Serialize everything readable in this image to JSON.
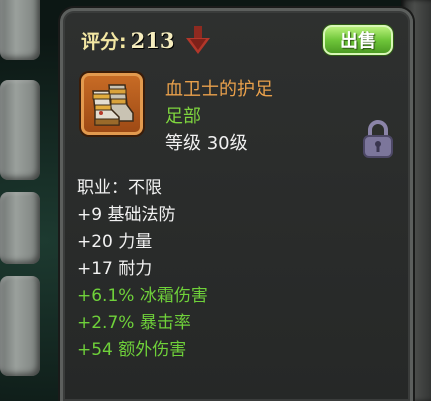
{
  "header": {
    "score_label": "评分:",
    "score_value": "213",
    "sell_button": "出售"
  },
  "item": {
    "name": "血卫士的护足",
    "slot": "足部",
    "level": "等级 30级",
    "icon": "armored-boots-icon"
  },
  "class_requirement": "职业：不限",
  "stats": [
    {
      "text": "+9 基础法防",
      "kind": "base"
    },
    {
      "text": "+20 力量",
      "kind": "base"
    },
    {
      "text": "+17 耐力",
      "kind": "base"
    },
    {
      "text": "+6.1% 冰霜伤害",
      "kind": "bonus"
    },
    {
      "text": "+2.7% 暴击率",
      "kind": "bonus"
    },
    {
      "text": "+54 额外伤害",
      "kind": "bonus"
    }
  ],
  "colors": {
    "item_name": "#e9a04b",
    "slot_text": "#7ed43e",
    "bonus_stat": "#6fd13a",
    "base_stat": "#f2f2f2",
    "sell_button": "#6fc63a",
    "score_down_arrow": "#b2372a"
  },
  "icons": {
    "score_trend": "down-arrow-icon",
    "lock": "padlock-icon"
  }
}
